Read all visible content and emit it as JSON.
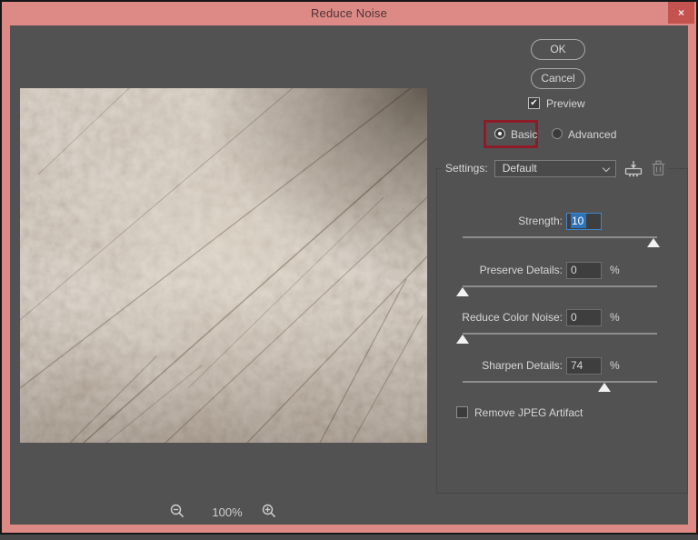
{
  "window": {
    "title": "Reduce Noise",
    "close_label": "×"
  },
  "buttons": {
    "ok": "OK",
    "cancel": "Cancel"
  },
  "preview_checkbox": {
    "label": "Preview",
    "checked": true
  },
  "mode": {
    "basic_label": "Basic",
    "advanced_label": "Advanced",
    "selected": "Basic"
  },
  "settings": {
    "label": "Settings:",
    "value": "Default"
  },
  "sliders": [
    {
      "label": "Strength:",
      "value": "10",
      "unit": "",
      "percent": 98,
      "focused": true,
      "value_selected": true
    },
    {
      "label": "Preserve Details:",
      "value": "0",
      "unit": "%",
      "percent": 0,
      "focused": false,
      "value_selected": false
    },
    {
      "label": "Reduce Color Noise:",
      "value": "0",
      "unit": "%",
      "percent": 0,
      "focused": false,
      "value_selected": false
    },
    {
      "label": "Sharpen Details:",
      "value": "74",
      "unit": "%",
      "percent": 73,
      "focused": false,
      "value_selected": false
    }
  ],
  "jpeg_checkbox": {
    "label": "Remove JPEG Artifact",
    "checked": false
  },
  "zoom_controls": {
    "level": "100%"
  },
  "colors": {
    "titlebar": "#dd8a86",
    "close_button": "#c4524f",
    "dialog_bg": "#525252",
    "annotation_red": "#8e1c28",
    "selection_blue": "#2e72b8",
    "focus_blue": "#3f87c9",
    "text": "#d6d6d6"
  }
}
